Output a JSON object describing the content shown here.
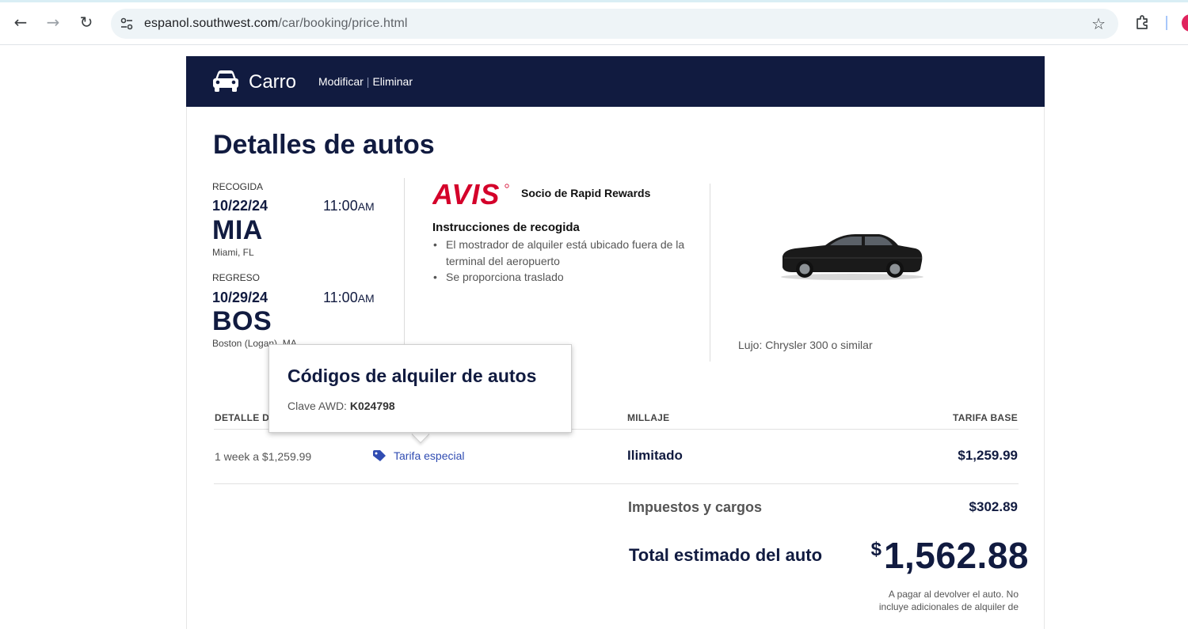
{
  "browser": {
    "url_host": "espanol.southwest.com",
    "url_path": "/car/booking/price.html"
  },
  "header": {
    "title": "Carro",
    "modify_label": "Modificar",
    "divider": "|",
    "delete_label": "Eliminar"
  },
  "page_title": "Detalles de autos",
  "pickup": {
    "label": "RECOGIDA",
    "date": "10/22/24",
    "time": "11:00",
    "ampm": "AM",
    "code": "MIA",
    "city": "Miami, FL"
  },
  "return": {
    "label": "REGRESO",
    "date": "10/29/24",
    "time": "11:00",
    "ampm": "AM",
    "code": "BOS",
    "city": "Boston (Logan), MA"
  },
  "vendor": {
    "logo_text": "AVIS",
    "partner_label": "Socio de Rapid Rewards",
    "instructions_title": "Instrucciones de recogida",
    "instructions": [
      "El mostrador de alquiler está ubicado fuera de la terminal del aeropuerto",
      "Se proporciona traslado"
    ]
  },
  "car_class": "Lujo: Chrysler 300 o similar",
  "table": {
    "headers": {
      "detail": "DETALLE DE",
      "mileage": "MILLAJE",
      "base_rate": "TARIFA BASE"
    },
    "row": {
      "detail": "1 week a $1,259.99",
      "special_rate": "Tarifa especial",
      "mileage": "Ilimitado",
      "base_rate": "$1,259.99"
    }
  },
  "taxes": {
    "label": "Impuestos y cargos",
    "value": "$302.89"
  },
  "total": {
    "label": "Total estimado del auto",
    "currency": "$",
    "amount": "1,562.88",
    "note": "A pagar al devolver el auto. No incluye adicionales de alquiler de"
  },
  "popup": {
    "title": "Códigos de alquiler de autos",
    "awd_label": "Clave AWD:",
    "awd_value": "K024798"
  },
  "colors": {
    "navy": "#111b40",
    "link_blue": "#304cb2",
    "avis_red": "#d4002a"
  }
}
